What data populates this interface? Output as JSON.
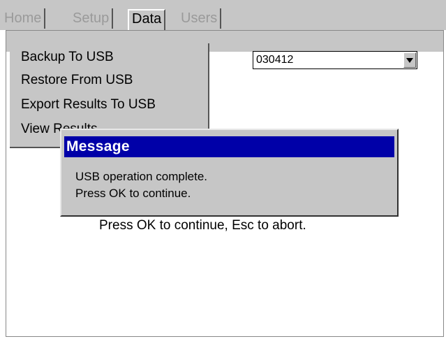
{
  "tabs": [
    {
      "label": "Home",
      "active": false
    },
    {
      "label": "Setup",
      "active": false
    },
    {
      "label": "Data",
      "active": true
    },
    {
      "label": "Users",
      "active": false
    }
  ],
  "menu": {
    "items": [
      "Backup To USB",
      "Restore From USB",
      "Export Results To USB",
      "View Results"
    ]
  },
  "select": {
    "value": "030412"
  },
  "background": {
    "prompt": "Press OK to continue, Esc to abort."
  },
  "dialog": {
    "title": "Message",
    "line1": "USB operation complete.",
    "line2": "Press OK to continue."
  },
  "colors": {
    "titlebar": "#0000a8",
    "chrome_gray": "#c6c6c6"
  }
}
